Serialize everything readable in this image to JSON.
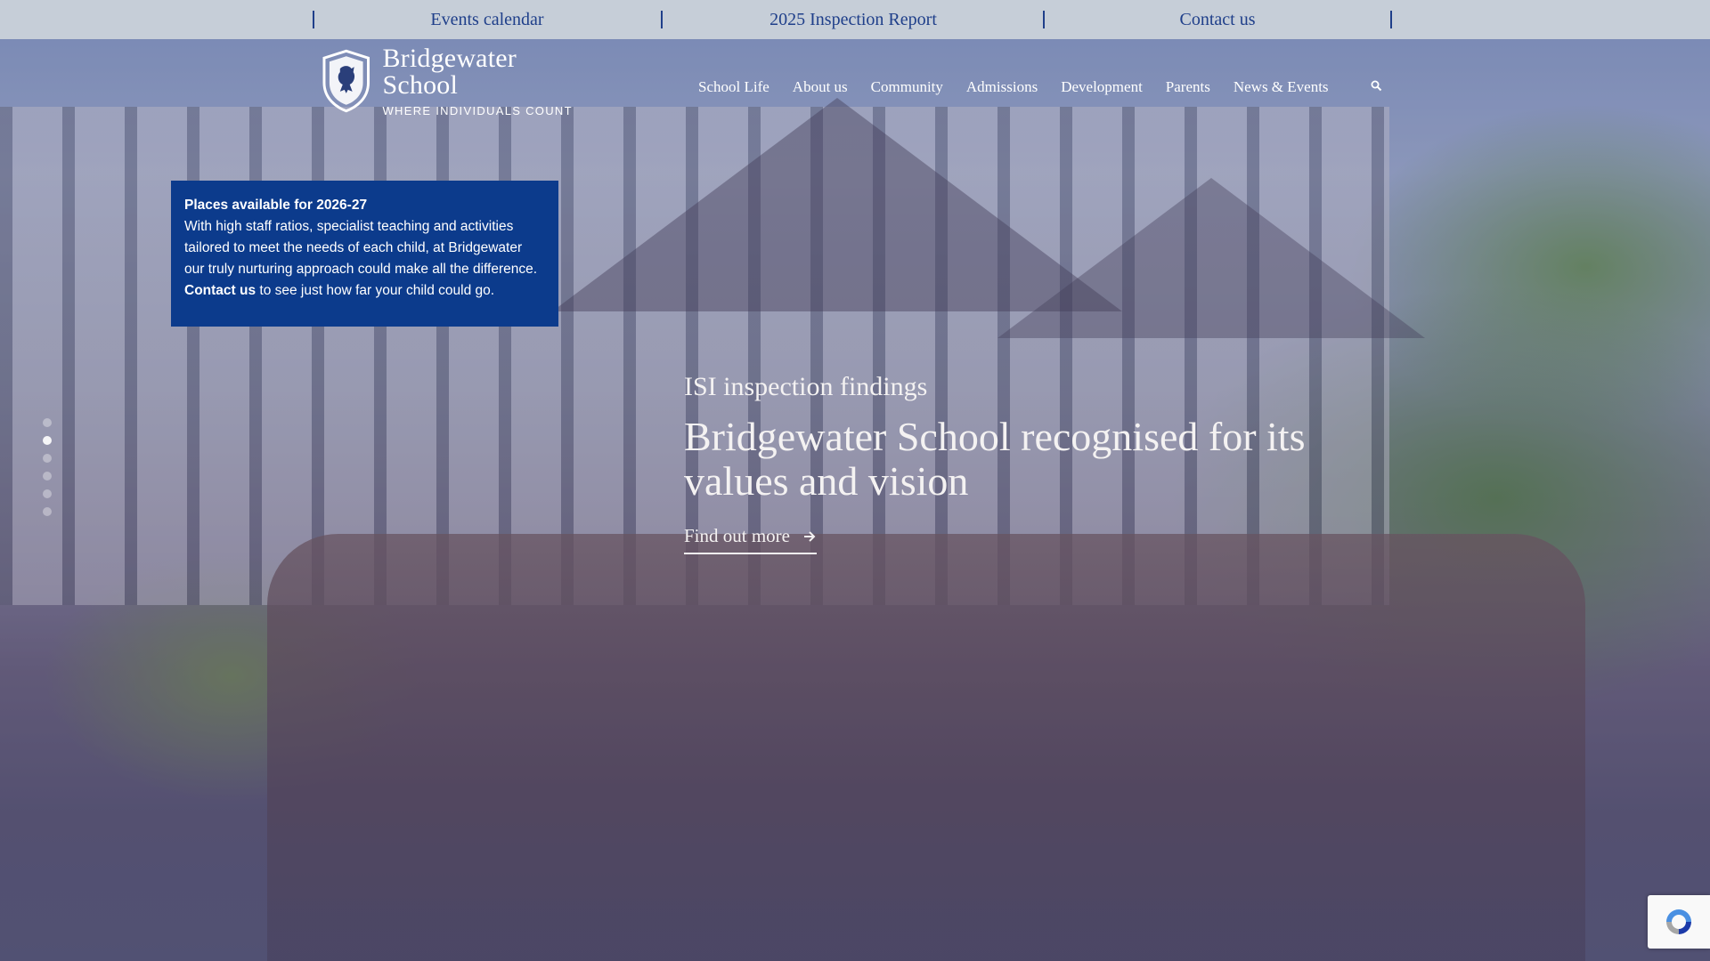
{
  "utility_bar": {
    "links": [
      {
        "label": "Events calendar"
      },
      {
        "label": "2025 Inspection Report"
      },
      {
        "label": "Contact us"
      }
    ]
  },
  "logo": {
    "name": "Bridgewater School",
    "tagline": "WHERE INDIVIDUALS COUNT"
  },
  "nav": {
    "items": [
      {
        "label": "School Life"
      },
      {
        "label": "About us"
      },
      {
        "label": "Community"
      },
      {
        "label": "Admissions"
      },
      {
        "label": "Development"
      },
      {
        "label": "Parents"
      },
      {
        "label": "News & Events"
      }
    ],
    "search_icon": "search-icon"
  },
  "infobox": {
    "heading": "Places available for 2026-27",
    "body": "With high staff ratios, specialist teaching and activities tailored to meet the needs of each child, at Bridgewater our truly nurturing approach could make all the difference.",
    "contact_link": "Contact us",
    "suffix": " to see just how far your child could go."
  },
  "slider": {
    "dot_count": 6,
    "active_index": 1
  },
  "hero": {
    "subtitle": "ISI inspection findings",
    "title": "Bridgewater School recognised for its values and vision",
    "cta_label": "Find out more"
  },
  "colors": {
    "utility_bg": "#c6ced8",
    "utility_text": "#1f3f8a",
    "infobox_bg": "#0c3b8c"
  }
}
